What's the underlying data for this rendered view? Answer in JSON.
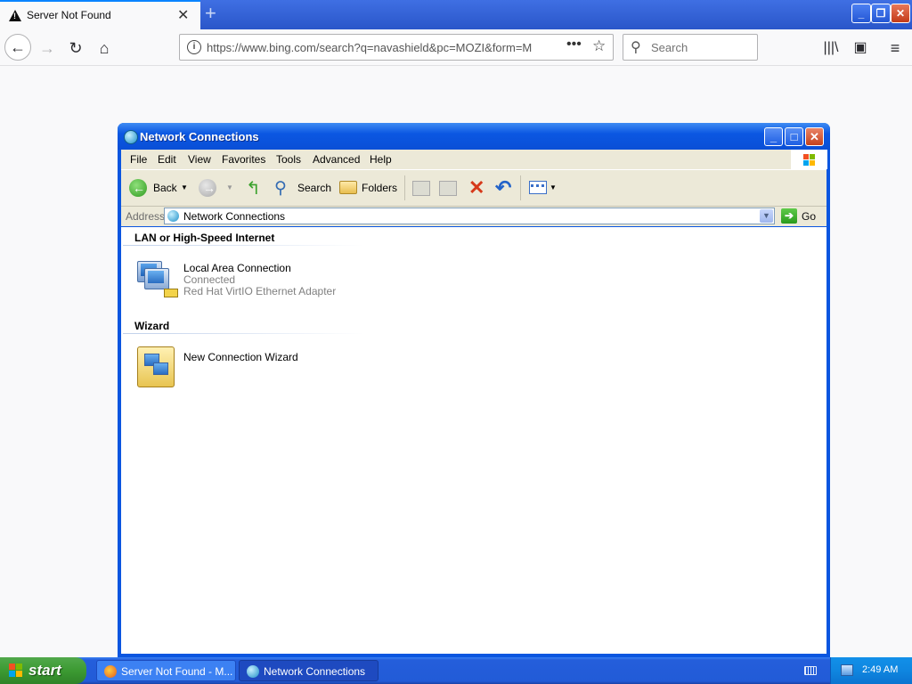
{
  "browser": {
    "tab_title": "Server Not Found",
    "url": "https://www.bing.com/search?q=navashield&pc=MOZI&form=M",
    "search_placeholder": "Search"
  },
  "explorer": {
    "title": "Network Connections",
    "menu": [
      "File",
      "Edit",
      "View",
      "Favorites",
      "Tools",
      "Advanced",
      "Help"
    ],
    "toolbar": {
      "back": "Back",
      "search": "Search",
      "folders": "Folders"
    },
    "address": {
      "label": "Address",
      "value": "Network Connections",
      "go": "Go"
    },
    "groups": [
      {
        "header": "LAN or High-Speed Internet",
        "items": [
          {
            "name": "Local Area Connection",
            "status": "Connected",
            "device": "Red Hat VirtIO Ethernet Adapter"
          }
        ]
      },
      {
        "header": "Wizard",
        "items": [
          {
            "name": "New Connection Wizard"
          }
        ]
      }
    ]
  },
  "taskbar": {
    "start_label": "start",
    "tasks": [
      "Server Not Found - M...",
      "Network Connections"
    ],
    "clock": "2:49 AM"
  }
}
